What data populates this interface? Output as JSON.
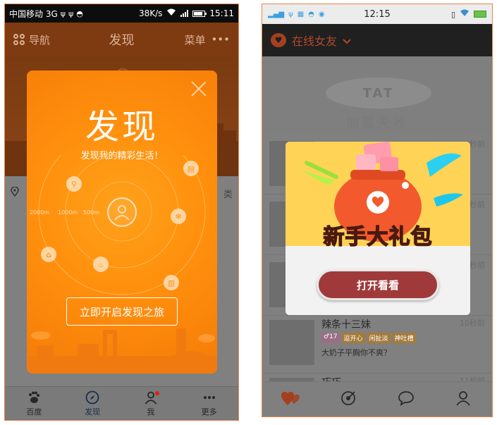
{
  "left_phone": {
    "status_bar": {
      "carrier": "中国移动 3G",
      "speed": "38K/s",
      "time": "15:11"
    },
    "header": {
      "nav_label": "导航",
      "title": "发现",
      "menu_label": "菜单"
    },
    "background": {
      "location_suffix": "类"
    },
    "discover_modal": {
      "title": "发现",
      "subtitle": "发现我的精彩生活！",
      "distances": [
        "2000m",
        "1000m",
        "500m"
      ],
      "start_button": "立即开启发现之旅"
    },
    "tab_bar": {
      "tabs": [
        {
          "label": "百度",
          "icon": "baidu-paw-icon"
        },
        {
          "label": "发现",
          "icon": "compass-icon",
          "active": true
        },
        {
          "label": "我",
          "icon": "person-icon",
          "badge": true
        },
        {
          "label": "更多",
          "icon": "more-dots-icon"
        }
      ]
    },
    "colors": {
      "accent": "#ff8f0d",
      "header": "#7e3a10"
    }
  },
  "right_phone": {
    "status_bar": {
      "time": "12:15"
    },
    "header": {
      "title": "在线女友"
    },
    "load_failed": {
      "logo_text": "TAT",
      "text": "加载失败"
    },
    "list": [
      {
        "time": "6秒前"
      },
      {
        "time": "7秒前"
      },
      {
        "time": "8秒前"
      },
      {
        "name": "辣条十三妹",
        "tags": [
          "♂17",
          "逗开心",
          "闲扯淡",
          "神吐槽"
        ],
        "message": "大奶子平胸你不爽？",
        "time": "10秒前"
      },
      {
        "name": "巧巧",
        "time": "11秒前"
      }
    ],
    "gift_modal": {
      "title_part1": "新手",
      "title_part2": "大",
      "title_part3": "礼包",
      "open_button": "打开看看"
    },
    "tab_bar": {
      "tabs": [
        {
          "icon": "hearts-icon"
        },
        {
          "icon": "target-icon"
        },
        {
          "icon": "chat-bubble-icon"
        },
        {
          "icon": "person-icon"
        }
      ]
    },
    "colors": {
      "accent": "#a03a3a",
      "gift_bg": "#ffd456"
    }
  }
}
